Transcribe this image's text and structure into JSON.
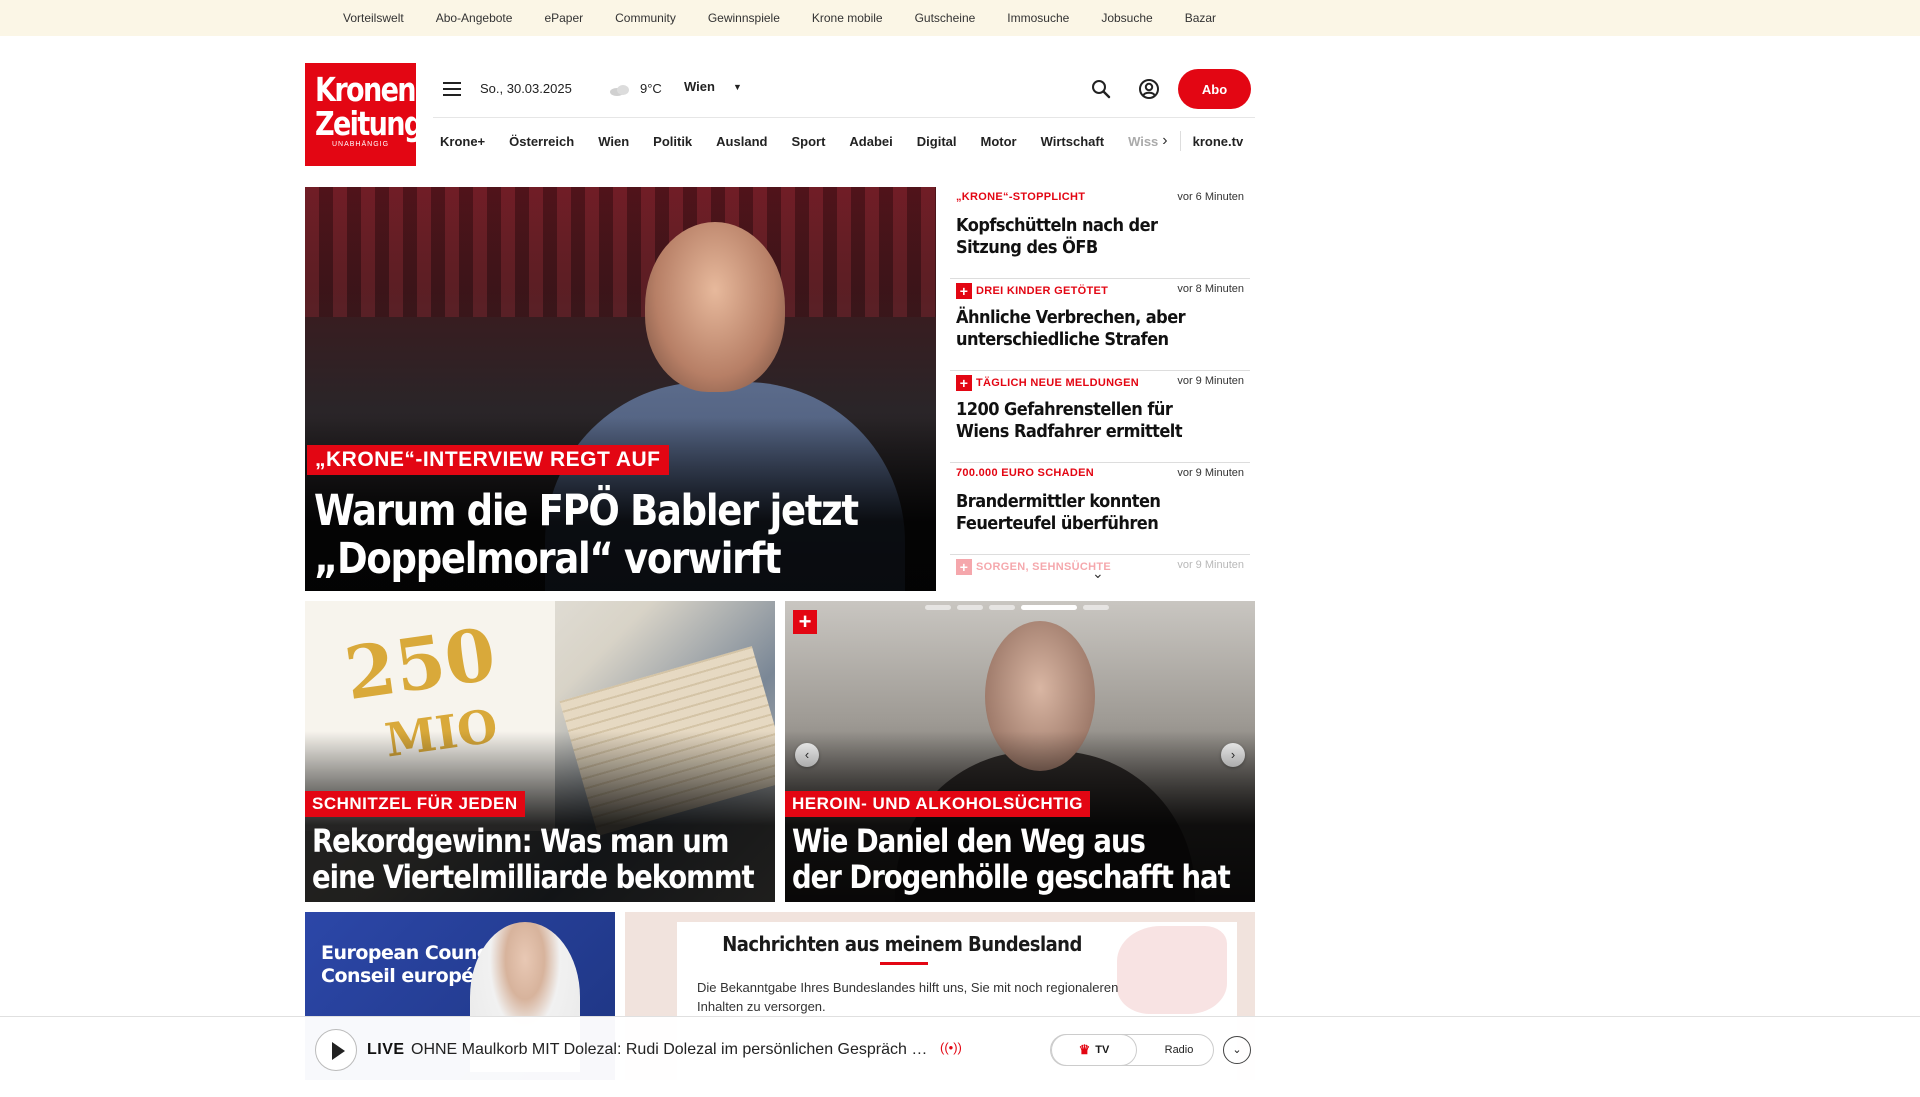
{
  "topnav": [
    "Vorteilswelt",
    "Abo-Angebote",
    "ePaper",
    "Community",
    "Gewinnspiele",
    "Krone mobile",
    "Gutscheine",
    "Immosuche",
    "Jobsuche",
    "Bazar"
  ],
  "logo": {
    "line1": "Kronen",
    "line2": "Zeitung",
    "tagline": "UNABHÄNGIG"
  },
  "header": {
    "date": "So., 30.03.2025",
    "temperature": "9°C",
    "city": "Wien",
    "abo_label": "Abo"
  },
  "mainnav": {
    "items": [
      "Krone+",
      "Österreich",
      "Wien",
      "Politik",
      "Ausland",
      "Sport",
      "Adabei",
      "Digital",
      "Motor",
      "Wirtschaft"
    ],
    "cutoff": "Wiss",
    "tv": "krone.tv"
  },
  "hero": {
    "kicker": "„KRONE“-INTERVIEW REGT AUF",
    "title_line1": "Warum die FPÖ Babler jetzt",
    "title_line2": "„Doppelmoral“ vorwirft"
  },
  "sidelist": [
    {
      "kicker": "„KRONE“-STOPPLICHT",
      "time": "vor 6 Minuten",
      "title": "Kopfschütteln nach der Sitzung des ÖFB",
      "plus": false
    },
    {
      "kicker": "DREI KINDER GETÖTET",
      "time": "vor 8 Minuten",
      "title": "Ähnliche Verbrechen, aber unterschiedliche Strafen",
      "plus": true
    },
    {
      "kicker": "TÄGLICH NEUE MELDUNGEN",
      "time": "vor 9 Minuten",
      "title": "1200 Gefahrenstellen für Wiens Radfahrer ermittelt",
      "plus": true
    },
    {
      "kicker": "700.000 EURO SCHADEN",
      "time": "vor 9 Minuten",
      "title": "Brandermittler konnten Feuerteufel überführen",
      "plus": false
    },
    {
      "kicker": "SORGEN, SEHNSÜCHTE",
      "time": "vor 9 Minuten",
      "title": "",
      "plus": true
    }
  ],
  "card1": {
    "kicker": "SCHNITZEL FÜR JEDEN",
    "title_line1": "Rekordgewinn: Was man um",
    "title_line2": "eine Viertelmilliarde bekommt",
    "img_num": "250",
    "img_word": "MIO"
  },
  "card2": {
    "kicker": "HEROIN- UND ALKOHOLSÜCHTIG",
    "title_line1": "Wie Daniel den Weg aus",
    "title_line2": "der Drogenhölle geschafft hat"
  },
  "card3": {
    "sign_line1": "European Council",
    "sign_line2": "Conseil européen"
  },
  "bundesland": {
    "title_pre": "Nachrichten aus ",
    "title_accent": "meinem",
    "title_post": " Bundesland",
    "text": "Die Bekanntgabe Ihres Bundeslandes hilft uns, Sie mit noch regionaleren Inhalten zu versorgen."
  },
  "livebar": {
    "label": "LIVE",
    "text": "OHNE Maulkorb MIT Dolezal: Rudi Dolezal im persönlichen Gespräch mi...",
    "tv": "TV",
    "radio": "Radio"
  },
  "colors": {
    "brand_red": "#e30613",
    "topbar_bg": "#fbf6e6"
  }
}
